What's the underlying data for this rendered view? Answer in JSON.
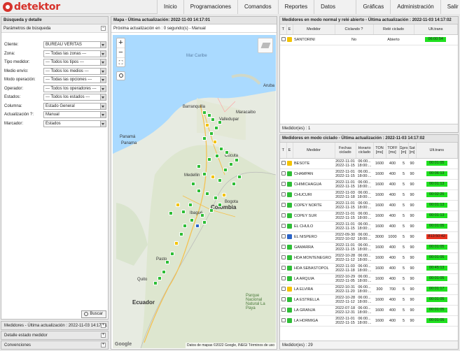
{
  "brand": {
    "name": "detektor"
  },
  "nav": [
    "Inicio",
    "Programaciones",
    "Comandos",
    "Reportes",
    "Datos Disponibles",
    "Gráficas",
    "Administración",
    "Salir"
  ],
  "left": {
    "title": "Búsqueda y detalle",
    "params_title": "Parámetros de búsqueda",
    "fields": [
      {
        "label": "Cliente:",
        "value": "BUREAU VERITAS"
      },
      {
        "label": "Zona:",
        "value": "--- Todas las zonas ---"
      },
      {
        "label": "Tipo medidor:",
        "value": "--- Todos los tipos ---"
      },
      {
        "label": "Medio envío:",
        "value": "--- Todos los medios ---"
      },
      {
        "label": "Modo operación:",
        "value": "--- Todas las opciones ---"
      },
      {
        "label": "Operador:",
        "value": "--- Todos los operadores ---"
      },
      {
        "label": "Estados:",
        "value": "--- Todos los estados ---"
      },
      {
        "label": "Columna:",
        "value": "Estado General"
      },
      {
        "label": "Actualización ?:",
        "value": "Manual"
      },
      {
        "label": "Marcador:",
        "value": "Estados"
      }
    ],
    "search_button": "Buscar",
    "collapsed": [
      "Medidores - Última actualización : 2022-11-03 14:17:01",
      "Detalle estado medidor",
      "Convenciones"
    ]
  },
  "map": {
    "title": "Mapa - Última actualización: 2022-11-03 14:17:01",
    "next_update": "Próxima actualización en : 0 segundo(s) - Manual",
    "labels": [
      "Mar Caribe",
      "Aruba",
      "Barranquilla",
      "Maracaibo",
      "Valledupar",
      "Panamá",
      "Panama",
      "Colombia",
      "Bogota",
      "Medellin",
      "Quito",
      "Ecuador",
      "Cúcuta",
      "Parque Nacional Natural La Paya",
      "Ibagué",
      "Pasto"
    ],
    "attribution": "Datos de mapas ©2022 Google, INEGI   Términos de uso"
  },
  "top_table": {
    "title": "Medidores en modo normal y relé abierto - Última actualización : 2022-11-03 14:17:02",
    "headers": [
      "T",
      "E",
      "Medidor",
      "Ciclando ?",
      "Relé ciclado",
      "Ult.trans"
    ],
    "rows": [
      {
        "name": "SANTORINI",
        "ciclando": "No",
        "rele": "Abierto",
        "ult": "06:00:54"
      }
    ],
    "count": "Medidor(es) : 1"
  },
  "bottom_table": {
    "title": "Medidores en modo ciclado - Última actualización : 2022-11-03 14:17:02",
    "headers": [
      "T",
      "E",
      "Medidor",
      "Fechas ciclado",
      "Horario ciclado",
      "TON [ms]",
      "TOFF [ms]",
      "Gprs [m]",
      "Sat [m]",
      "Ult.trans"
    ],
    "rows": [
      {
        "e": "y",
        "name": "BESOTE",
        "f1": "2022-11-01",
        "f2": "2022-11-15",
        "h": "06:00... 18:00:...",
        "ton": "1600",
        "toff": "400",
        "g": "5",
        "s": "90",
        "ult": "00:01:05",
        "c": "g"
      },
      {
        "e": "g",
        "name": "CHAMPAN",
        "f1": "2022-11-01",
        "f2": "2022-11-15",
        "h": "06:00... 18:00:...",
        "ton": "1600",
        "toff": "400",
        "g": "5",
        "s": "90",
        "ult": "00:06:13",
        "c": "g"
      },
      {
        "e": "g",
        "name": "CHIMICHAGUA",
        "f1": "2022-11-01",
        "f2": "2022-11-15",
        "h": "06:00... 18:00:...",
        "ton": "1600",
        "toff": "400",
        "g": "5",
        "s": "90",
        "ult": "00:01:13",
        "c": "g"
      },
      {
        "e": "g",
        "name": "CHUCURI",
        "f1": "2022-11-03",
        "f2": "2022-11-18",
        "h": "06:00... 18:00:...",
        "ton": "1600",
        "toff": "400",
        "g": "5",
        "s": "90",
        "ult": "00:02:25",
        "c": "g"
      },
      {
        "e": "g",
        "name": "COPEY NORTE",
        "f1": "2022-11-01",
        "f2": "2022-11-15",
        "h": "06:00... 18:00:...",
        "ton": "1600",
        "toff": "400",
        "g": "5",
        "s": "90",
        "ult": "00:01:13",
        "c": "g"
      },
      {
        "e": "g",
        "name": "COPEY SUR",
        "f1": "2022-11-01",
        "f2": "2022-11-15",
        "h": "06:00... 18:00:...",
        "ton": "1600",
        "toff": "400",
        "g": "5",
        "s": "90",
        "ult": "00:01:13",
        "c": "g"
      },
      {
        "e": "g",
        "name": "EL CHULO",
        "f1": "2022-11-01",
        "f2": "2022-11-15",
        "h": "06:00... 18:00:...",
        "ton": "1600",
        "toff": "400",
        "g": "5",
        "s": "90",
        "ult": "00:01:05",
        "c": "g"
      },
      {
        "e": "b",
        "name": "EL NISPERO",
        "f1": "2022-09-30",
        "f2": "2022-10-02",
        "h": "06:00... 18:00:...",
        "ton": "3000",
        "toff": "1000",
        "g": "5",
        "s": "90",
        "ult": "813:50:42",
        "c": "r"
      },
      {
        "e": "g",
        "name": "GAMARRA",
        "f1": "2022-11-01",
        "f2": "2022-11-15",
        "h": "06:00... 18:00:...",
        "ton": "1600",
        "toff": "400",
        "g": "5",
        "s": "90",
        "ult": "00:01:05",
        "c": "g"
      },
      {
        "e": "g",
        "name": "HDA MONTENEGRO",
        "f1": "2022-10-28",
        "f2": "2022-11-12",
        "h": "06:00... 18:00:...",
        "ton": "1600",
        "toff": "400",
        "g": "5",
        "s": "90",
        "ult": "00:01:05",
        "c": "g"
      },
      {
        "e": "g",
        "name": "HDA SEBASTOPOL",
        "f1": "2022-11-03",
        "f2": "2022-11-18",
        "h": "06:00... 18:00:...",
        "ton": "1600",
        "toff": "400",
        "g": "5",
        "s": "90",
        "ult": "00:45:13",
        "c": "g"
      },
      {
        "e": "g",
        "name": "LA ARQUIA",
        "f1": "2022-10-29",
        "f2": "2022-11-05",
        "h": "06:00... 18:00:...",
        "ton": "1600",
        "toff": "400",
        "g": "5",
        "s": "90",
        "ult": "00:01:05",
        "c": "g"
      },
      {
        "e": "y",
        "name": "LA ELVIRA",
        "f1": "2022-10-31",
        "f2": "2022-11-20",
        "h": "06:00... 18:00:...",
        "ton": "300",
        "toff": "700",
        "g": "5",
        "s": "90",
        "ult": "00:01:17",
        "c": "g"
      },
      {
        "e": "g",
        "name": "LA ESTRELLA",
        "f1": "2022-10-28",
        "f2": "2022-11-12",
        "h": "06:00... 18:00:...",
        "ton": "1600",
        "toff": "400",
        "g": "5",
        "s": "90",
        "ult": "00:01:05",
        "c": "g"
      },
      {
        "e": "g",
        "name": "LA GRANJA",
        "f1": "2022-07-18",
        "f2": "2022-12-31",
        "h": "06:00... 18:00:...",
        "ton": "1600",
        "toff": "400",
        "g": "5",
        "s": "90",
        "ult": "00:01:05",
        "c": "g"
      },
      {
        "e": "g",
        "name": "LA HORMIGA",
        "f1": "2022-11-01",
        "f2": "2022-11-15",
        "h": "06:00... 18:00:...",
        "ton": "1600",
        "toff": "400",
        "g": "5",
        "s": "90",
        "ult": "00:01:05",
        "c": "g"
      }
    ],
    "count": "Medidor(es) : 29"
  },
  "colors": {
    "green": "#1fe01f",
    "red": "#e8321f",
    "yellow": "#f3c300",
    "blue": "#2a63c7",
    "brand": "#d6322b"
  }
}
